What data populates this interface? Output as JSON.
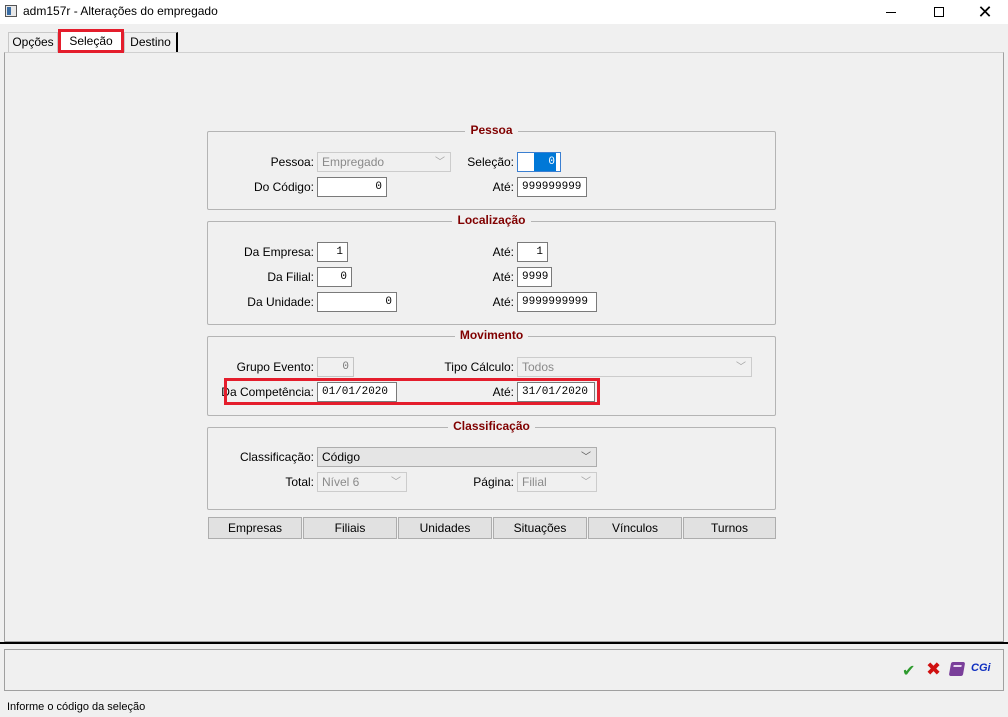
{
  "window": {
    "title": "adm157r - Alterações do empregado",
    "min_icon": "minimize-icon",
    "max_icon": "maximize-icon",
    "close_label": "✕"
  },
  "tabs": [
    {
      "label": "Opções"
    },
    {
      "label": "Seleção",
      "active": true
    },
    {
      "label": "Destino"
    }
  ],
  "pessoa": {
    "title": "Pessoa",
    "pessoa_label": "Pessoa:",
    "pessoa_value": "Empregado",
    "selecao_label": "Seleção:",
    "selecao_value": "0",
    "do_codigo_label": "Do Código:",
    "do_codigo_value": "0",
    "ate_label": "Até:",
    "ate_value": "999999999"
  },
  "localizacao": {
    "title": "Localização",
    "da_empresa_label": "Da Empresa:",
    "da_empresa_value": "1",
    "ate_empresa_label": "Até:",
    "ate_empresa_value": "1",
    "da_filial_label": "Da Filial:",
    "da_filial_value": "0",
    "ate_filial_label": "Até:",
    "ate_filial_value": "9999",
    "da_unidade_label": "Da Unidade:",
    "da_unidade_value": "0",
    "ate_unidade_label": "Até:",
    "ate_unidade_value": "9999999999"
  },
  "movimento": {
    "title": "Movimento",
    "grupo_evento_label": "Grupo Evento:",
    "grupo_evento_value": "0",
    "tipo_calculo_label": "Tipo Cálculo:",
    "tipo_calculo_value": "Todos",
    "da_competencia_label": "Da Competência:",
    "da_competencia_value": "01/01/2020",
    "ate_competencia_label": "Até:",
    "ate_competencia_value": "31/01/2020"
  },
  "classificacao": {
    "title": "Classificação",
    "classificacao_label": "Classificação:",
    "classificacao_value": "Código",
    "total_label": "Total:",
    "total_value": "Nível 6",
    "pagina_label": "Página:",
    "pagina_value": "Filial"
  },
  "buttons": [
    "Empresas",
    "Filiais",
    "Unidades",
    "Situações",
    "Vínculos",
    "Turnos"
  ],
  "toolbar": {
    "ok_glyph": "✔",
    "cancel_glyph": "✖",
    "cgi_label": "CGi"
  },
  "status": {
    "text": "Informe o código da seleção"
  },
  "colors": {
    "group_title": "#800000",
    "highlight": "#e41d2c",
    "selection": "#0078d7"
  }
}
